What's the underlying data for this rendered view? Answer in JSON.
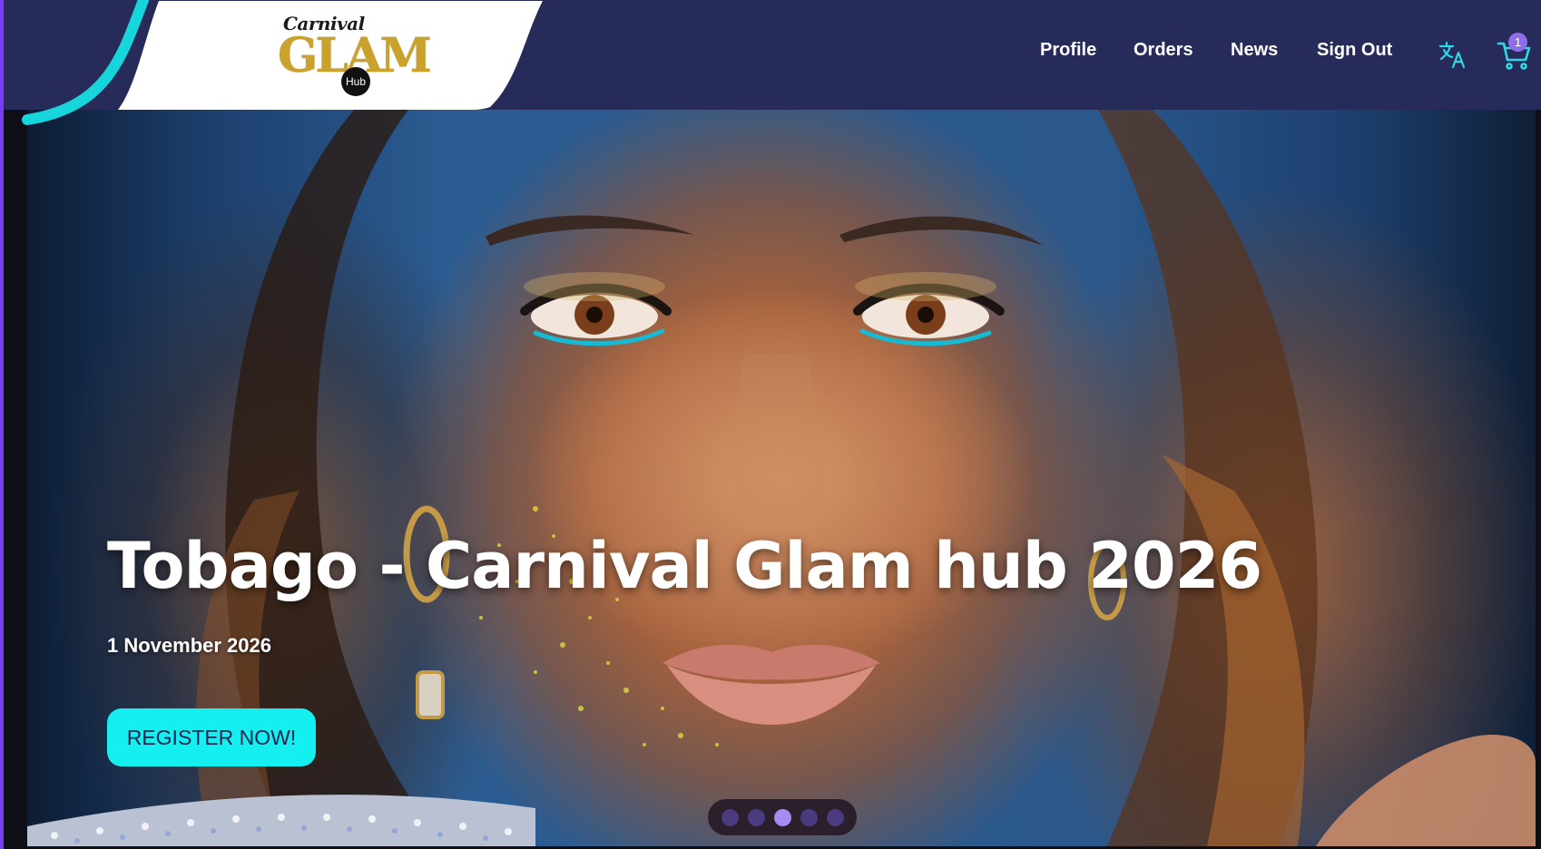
{
  "header": {
    "logo": {
      "script_text": "Carnival",
      "main_text": "GLAM",
      "badge_text": "Hub"
    },
    "nav": [
      {
        "label": "Profile"
      },
      {
        "label": "Orders"
      },
      {
        "label": "News"
      },
      {
        "label": "Sign Out"
      }
    ],
    "translate_icon": "translate-icon",
    "cart": {
      "icon": "cart-icon",
      "count": "1"
    }
  },
  "hero": {
    "title": "Tobago - Carnival Glam hub 2026",
    "date": "1 November 2026",
    "cta_label": "REGISTER NOW!",
    "carousel": {
      "total_slides": 5,
      "active_index": 2
    }
  },
  "colors": {
    "header_bg": "#262b5a",
    "accent_cyan": "#15efef",
    "cta_text": "#1d2552",
    "badge": "#8d6ee8",
    "dot_active": "#a68cf0",
    "dot_inactive": "#4a3a7f"
  }
}
